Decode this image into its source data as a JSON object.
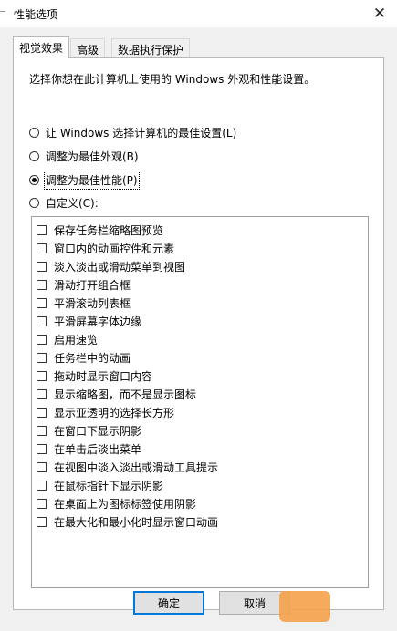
{
  "window": {
    "title": "性能选项",
    "close_glyph": "✕"
  },
  "tabs": [
    {
      "label": "视觉效果",
      "active": true
    },
    {
      "label": "高级",
      "active": false
    },
    {
      "label": "数据执行保护",
      "active": false
    }
  ],
  "visual": {
    "description": "选择你想在此计算机上使用的 Windows 外观和性能设置。",
    "radios": [
      {
        "label": "让 Windows 选择计算机的最佳设置(L)",
        "checked": false
      },
      {
        "label": "调整为最佳外观(B)",
        "checked": false
      },
      {
        "label": "调整为最佳性能(P)",
        "checked": true
      },
      {
        "label": "自定义(C):",
        "checked": false
      }
    ],
    "options": [
      "保存任务栏缩略图预览",
      "窗口内的动画控件和元素",
      "淡入淡出或滑动菜单到视图",
      "滑动打开组合框",
      "平滑滚动列表框",
      "平滑屏幕字体边缘",
      "启用速览",
      "任务栏中的动画",
      "拖动时显示窗口内容",
      "显示缩略图，而不是显示图标",
      "显示亚透明的选择长方形",
      "在窗口下显示阴影",
      "在单击后淡出菜单",
      "在视图中淡入淡出或滑动工具提示",
      "在鼠标指针下显示阴影",
      "在桌面上为图标标签使用阴影",
      "在最大化和最小化时显示窗口动画"
    ]
  },
  "buttons": {
    "ok": "确定",
    "cancel": "取消"
  },
  "colors": {
    "accent": "#0078d7",
    "dialog_bg": "#f0f0f0",
    "panel_bg": "#ffffff"
  }
}
